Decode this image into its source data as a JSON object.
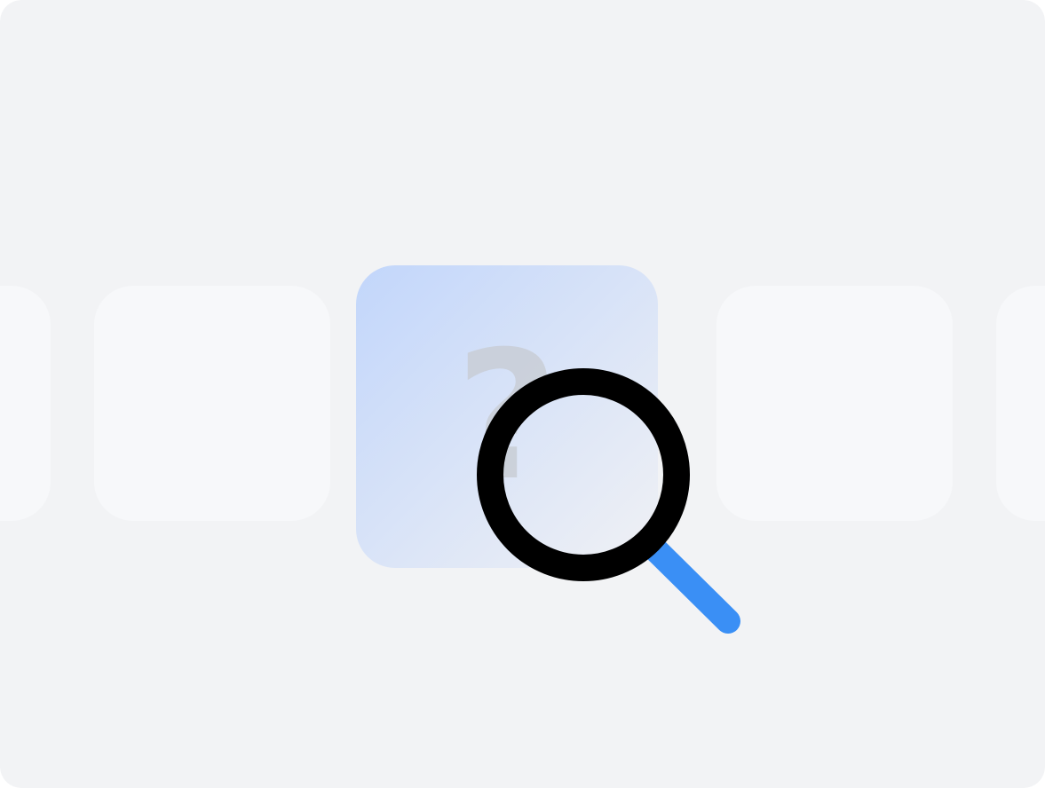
{
  "placeholder": {
    "glyph": "?",
    "icon": "magnifying-glass-icon"
  },
  "colors": {
    "background": "#f2f3f5",
    "card": "#f7f8fa",
    "focus_gradient_start": "#c2d6fb",
    "focus_gradient_end": "#f0f1f4",
    "glyph": "#c9ced6",
    "lens_ring": "#000000",
    "handle": "#3a8ff5"
  }
}
